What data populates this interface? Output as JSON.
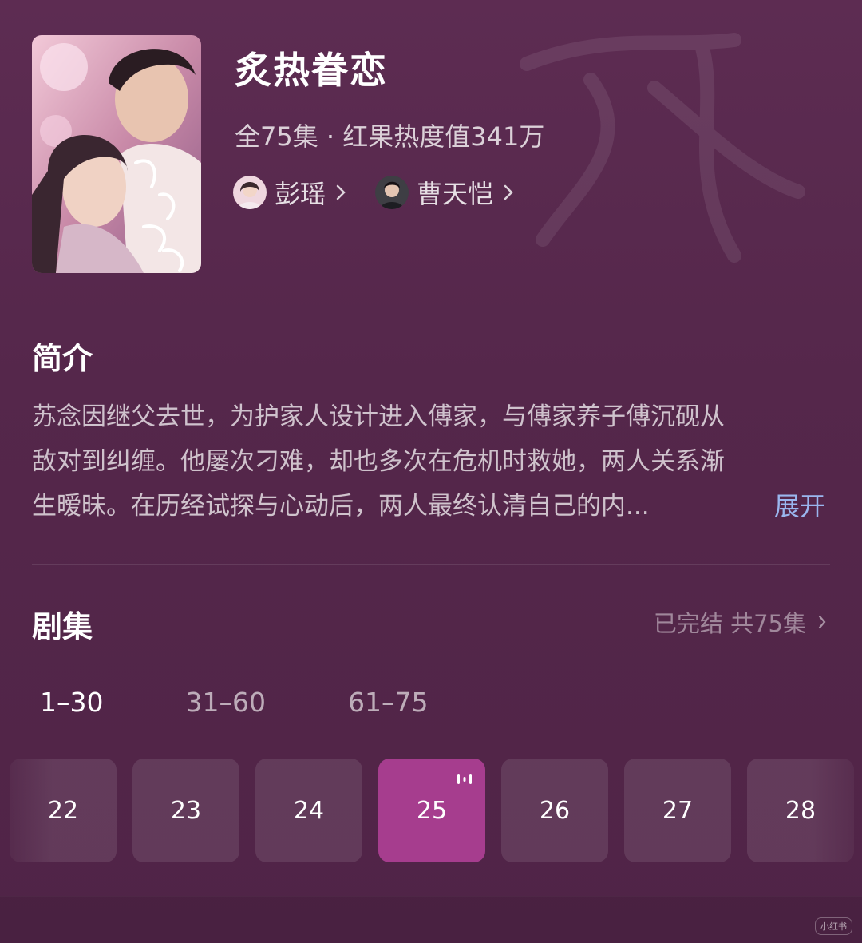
{
  "show": {
    "title": "炙热眷恋",
    "meta": "全75集 · 红果热度值341万",
    "cast": [
      {
        "name": "彭瑶"
      },
      {
        "name": "曹天恺"
      }
    ]
  },
  "synopsis": {
    "heading": "简介",
    "lines": [
      "苏念因继父去世，为护家人设计进入傅家，与傅家养子傅沉砚从",
      "敌对到纠缠。他屡次刁难，却也多次在危机时救她，两人关系渐",
      "生暧昧。在历经试探与心动后，两人最终认清自己的内..."
    ],
    "expand_label": "展开"
  },
  "episodes": {
    "heading": "剧集",
    "status": "已完结 共75集",
    "ranges": [
      "1–30",
      "31–60",
      "61–75"
    ],
    "active_range_index": 0,
    "items": [
      "22",
      "23",
      "24",
      "25",
      "26",
      "27",
      "28"
    ],
    "current": "25"
  },
  "watermark": "小红书",
  "colors": {
    "background": "#56294a",
    "active_episode": "#a63d8e",
    "expand_link": "#9ab6ee"
  }
}
